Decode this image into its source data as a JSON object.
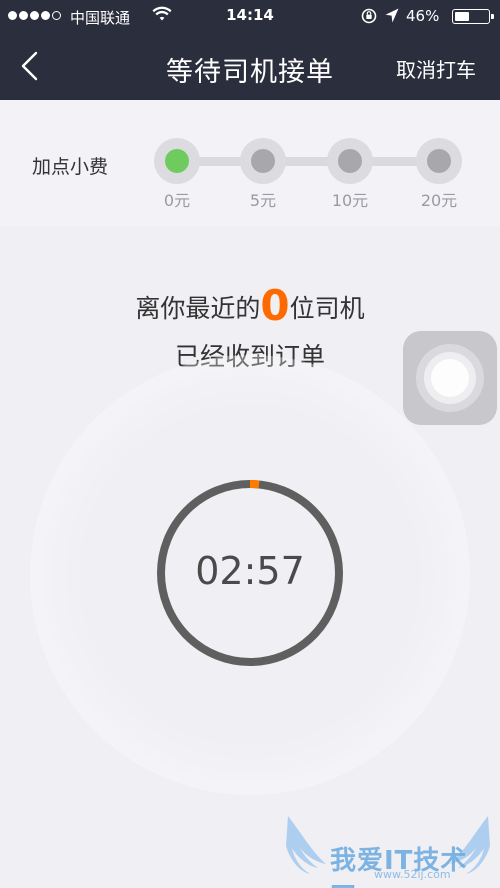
{
  "status_bar": {
    "carrier": "中国联通",
    "time": "14:14",
    "battery": "46%",
    "battery_level": 0.46,
    "signal_bars": 4,
    "signal_total": 5
  },
  "nav": {
    "title": "等待司机接单",
    "back_icon": "chevron-left-icon",
    "cancel_label": "取消打车"
  },
  "tip": {
    "label": "加点小费",
    "selected_index": 0,
    "options": [
      {
        "amount": "0元"
      },
      {
        "amount": "5元"
      },
      {
        "amount": "10元"
      },
      {
        "amount": "20元"
      }
    ],
    "selected_color": "#6fcb5e"
  },
  "message": {
    "prefix": "离你最近的",
    "count": "0",
    "suffix": "位司机",
    "line2": "已经收到订单",
    "accent_color": "#ff6a00"
  },
  "timer": {
    "countdown": "02:57"
  },
  "watermark": {
    "text": "我爱IT技术网",
    "url": "www.52ij.com"
  },
  "colors": {
    "header_bg": "#2b2e3d",
    "page_bg": "#efeff4",
    "timer_ring": "#5f5f5f",
    "timer_progress": "#ff7b00"
  }
}
